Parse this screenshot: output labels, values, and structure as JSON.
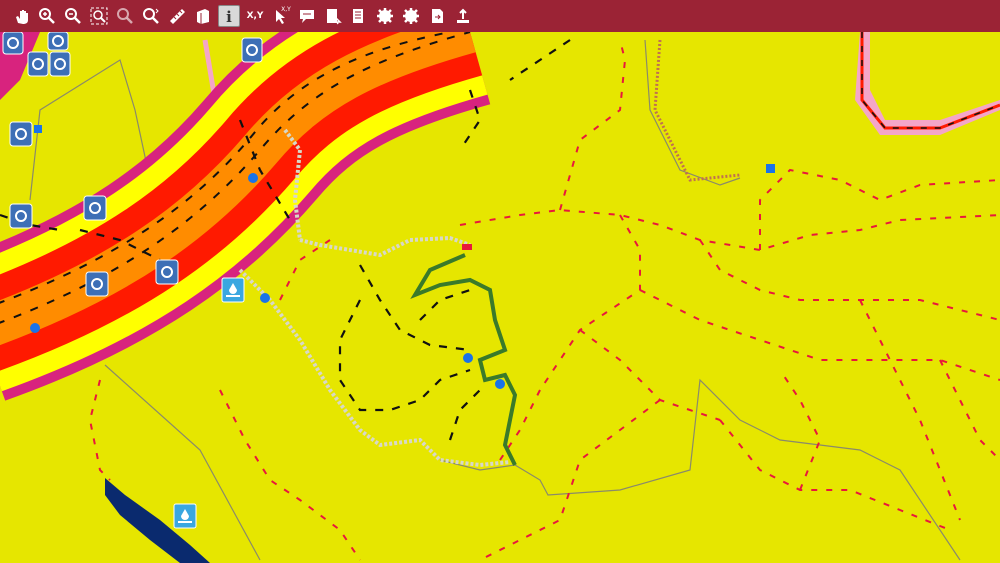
{
  "toolbar": {
    "tools": [
      {
        "id": "pan",
        "icon": "hand-icon"
      },
      {
        "id": "zoom-in",
        "icon": "zoom-in-icon"
      },
      {
        "id": "zoom-out",
        "icon": "zoom-out-icon"
      },
      {
        "id": "zoom-extent",
        "icon": "zoom-extent-icon"
      },
      {
        "id": "zoom-previous",
        "icon": "zoom-previous-icon"
      },
      {
        "id": "zoom-next",
        "icon": "zoom-next-icon"
      },
      {
        "id": "measure",
        "icon": "ruler-icon"
      },
      {
        "id": "layers",
        "icon": "layers-icon"
      },
      {
        "id": "identify",
        "icon": "info-icon",
        "active": true
      },
      {
        "id": "xy",
        "icon": "xy-icon",
        "label": "X,Y"
      },
      {
        "id": "goto-xy",
        "icon": "cursor-xy-icon",
        "label": "X,Y"
      },
      {
        "id": "comment",
        "icon": "speech-bubble-icon"
      },
      {
        "id": "select",
        "icon": "select-feature-icon"
      },
      {
        "id": "select-list",
        "icon": "select-list-icon"
      },
      {
        "id": "settings-1",
        "icon": "gear-icon"
      },
      {
        "id": "settings-2",
        "icon": "gear-icon"
      },
      {
        "id": "export",
        "icon": "export-icon"
      },
      {
        "id": "upload",
        "icon": "upload-icon"
      }
    ]
  },
  "colors": {
    "toolbar": "#9b2335",
    "land": "#e6e600",
    "corridor_outer": "#d8237e",
    "corridor_mid": "#ff1a00",
    "corridor_center": "#ff8c00",
    "corridor_yellow": "#ffff00",
    "route_green": "#3a7a2a",
    "trail_red": "#e8173c",
    "water": "#0a2a6e",
    "marker_blue": "#1a73e8",
    "boundary_gray": "#8a8a6a",
    "pink_road": "#f4a6c8"
  }
}
